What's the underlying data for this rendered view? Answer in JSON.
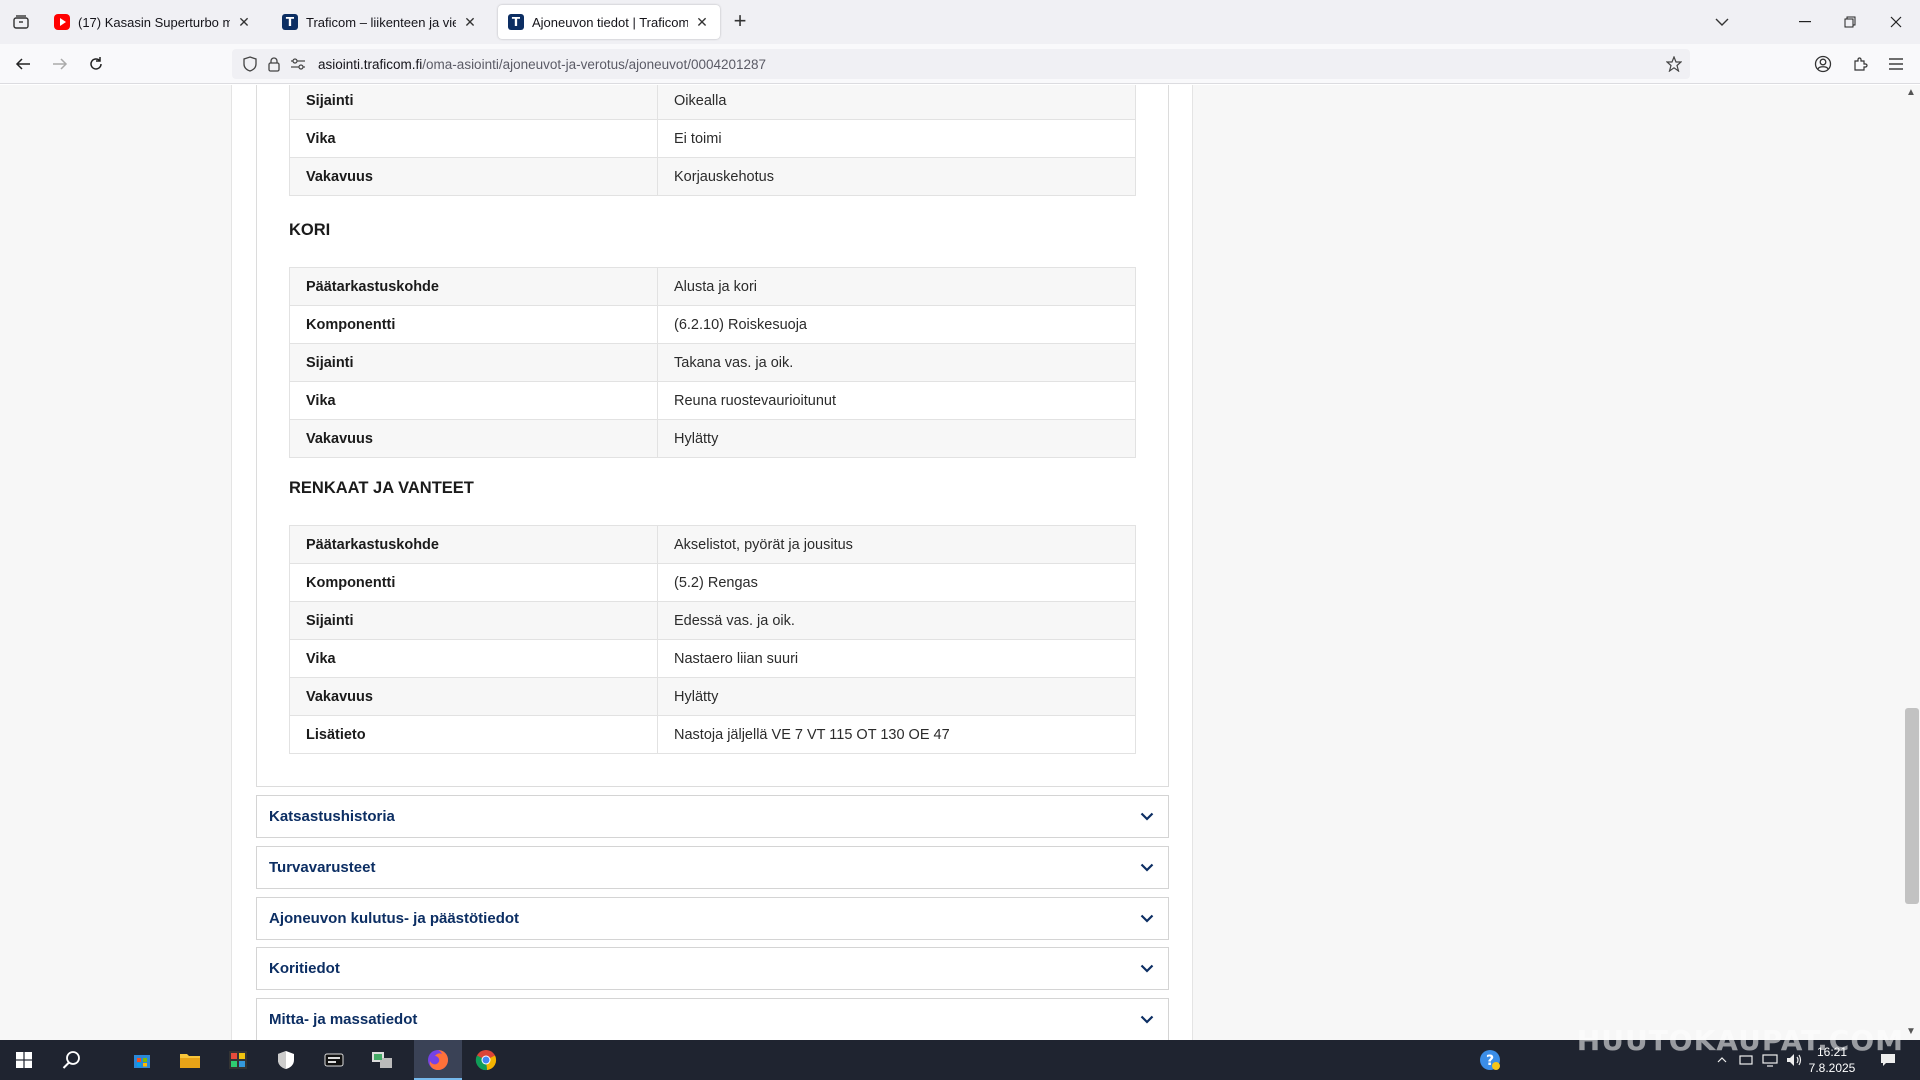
{
  "browser": {
    "tabs": [
      {
        "title": "(17) Kasasin Superturbo mersun",
        "favicon": "youtube-icon"
      },
      {
        "title": "Traficom – liikenteen ja viestinn",
        "favicon": "traficom-icon"
      },
      {
        "title": "Ajoneuvon tiedot | Traficom",
        "favicon": "traficom-icon",
        "active": true
      }
    ],
    "favicon_letter": "T",
    "url_domain": "asiointi.traficom.fi",
    "url_path": "/oma-asiointi/ajoneuvot-ja-verotus/ajoneuvot/0004201287"
  },
  "first_table": {
    "rows": [
      {
        "label": "Sijainti",
        "value": "Oikealla"
      },
      {
        "label": "Vika",
        "value": "Ei toimi"
      },
      {
        "label": "Vakavuus",
        "value": "Korjauskehotus"
      }
    ]
  },
  "kori": {
    "title": "KORI",
    "rows": [
      {
        "label": "Päätarkastuskohde",
        "value": "Alusta ja kori"
      },
      {
        "label": "Komponentti",
        "value": "(6.2.10) Roiskesuoja"
      },
      {
        "label": "Sijainti",
        "value": "Takana vas. ja oik."
      },
      {
        "label": "Vika",
        "value": "Reuna ruostevaurioitunut"
      },
      {
        "label": "Vakavuus",
        "value": "Hylätty"
      }
    ]
  },
  "renkaat": {
    "title": "RENKAAT JA VANTEET",
    "rows": [
      {
        "label": "Päätarkastuskohde",
        "value": "Akselistot, pyörät ja jousitus"
      },
      {
        "label": "Komponentti",
        "value": "(5.2) Rengas"
      },
      {
        "label": "Sijainti",
        "value": "Edessä vas. ja oik."
      },
      {
        "label": "Vika",
        "value": "Nastaero liian suuri"
      },
      {
        "label": "Vakavuus",
        "value": "Hylätty"
      },
      {
        "label": "Lisätieto",
        "value": "Nastoja jäljellä VE 7 VT 115 OT 130 OE 47"
      }
    ]
  },
  "accordions": [
    {
      "label": "Katsastushistoria"
    },
    {
      "label": "Turvavarusteet"
    },
    {
      "label": "Ajoneuvon kulutus- ja päästötiedot"
    },
    {
      "label": "Koritiedot"
    },
    {
      "label": "Mitta- ja massatiedot"
    }
  ],
  "taskbar": {
    "time": "16:21",
    "date": "7.8.2025",
    "watermark": "HUUTOKAUPAT.COM"
  },
  "colors": {
    "link_navy": "#0c2e63",
    "table_stripe": "#f7f7f7",
    "taskbar": "#1f2430"
  }
}
